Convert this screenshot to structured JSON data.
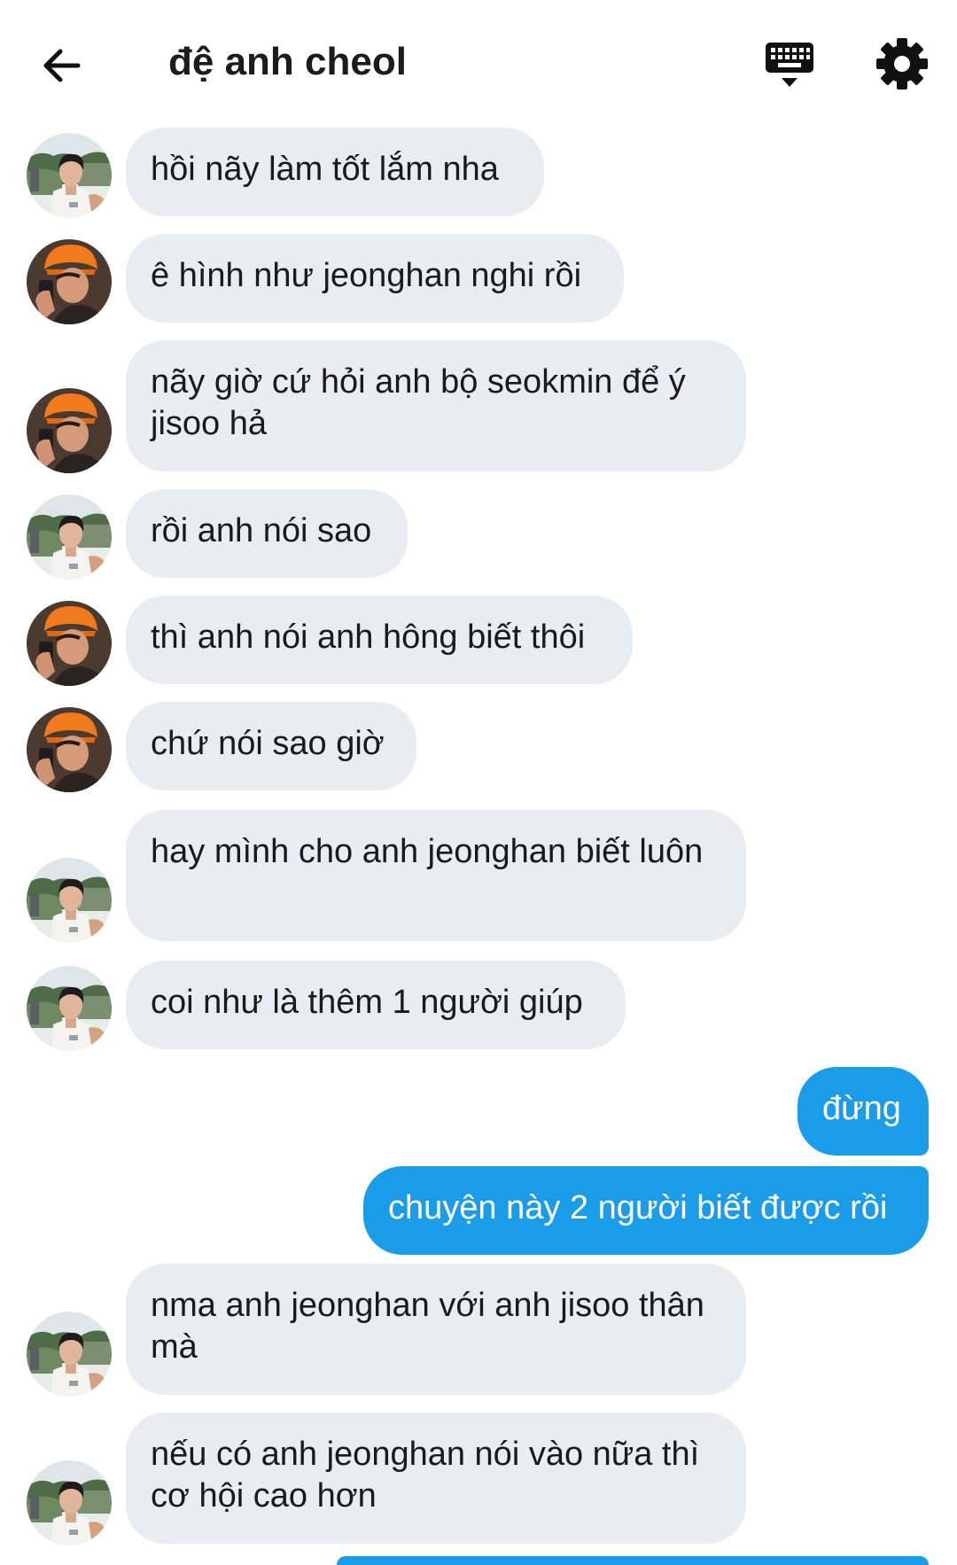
{
  "header": {
    "title": "đệ anh cheol",
    "back_icon": "arrow-left-icon",
    "keyboard_icon": "keyboard-icon",
    "settings_icon": "gear-icon"
  },
  "colors": {
    "incoming_bubble": "#e9edf1",
    "outgoing_bubble": "#1a9ce8",
    "text": "#1a1a1a",
    "outgoing_text": "#ffffff"
  },
  "messages": [
    {
      "direction": "in",
      "avatar": "avatar-a",
      "text": "hồi nãy làm tốt lắm nha"
    },
    {
      "direction": "in",
      "avatar": "avatar-b",
      "text": "ê hình như jeonghan nghi rồi"
    },
    {
      "direction": "in",
      "avatar": "avatar-b",
      "text": "nãy giờ cứ hỏi anh bộ seokmin để ý jisoo hả"
    },
    {
      "direction": "in",
      "avatar": "avatar-a",
      "text": "rồi anh nói sao"
    },
    {
      "direction": "in",
      "avatar": "avatar-b",
      "text": "thì anh nói anh hông biết thôi"
    },
    {
      "direction": "in",
      "avatar": "avatar-b",
      "text": "chứ nói sao giờ"
    },
    {
      "direction": "in",
      "avatar": "avatar-a",
      "text": "hay mình cho anh jeonghan biết luôn"
    },
    {
      "direction": "in",
      "avatar": "avatar-a",
      "text": "coi như là thêm 1 người giúp"
    },
    {
      "direction": "out",
      "text": "đừng"
    },
    {
      "direction": "out",
      "text": "chuyện này 2 người biết được rồi"
    },
    {
      "direction": "in",
      "avatar": "avatar-a",
      "text": "nma anh jeonghan với anh jisoo thân mà"
    },
    {
      "direction": "in",
      "avatar": "avatar-a",
      "text": "nếu có anh jeonghan nói vào nữa thì cơ hội cao hơn"
    }
  ]
}
